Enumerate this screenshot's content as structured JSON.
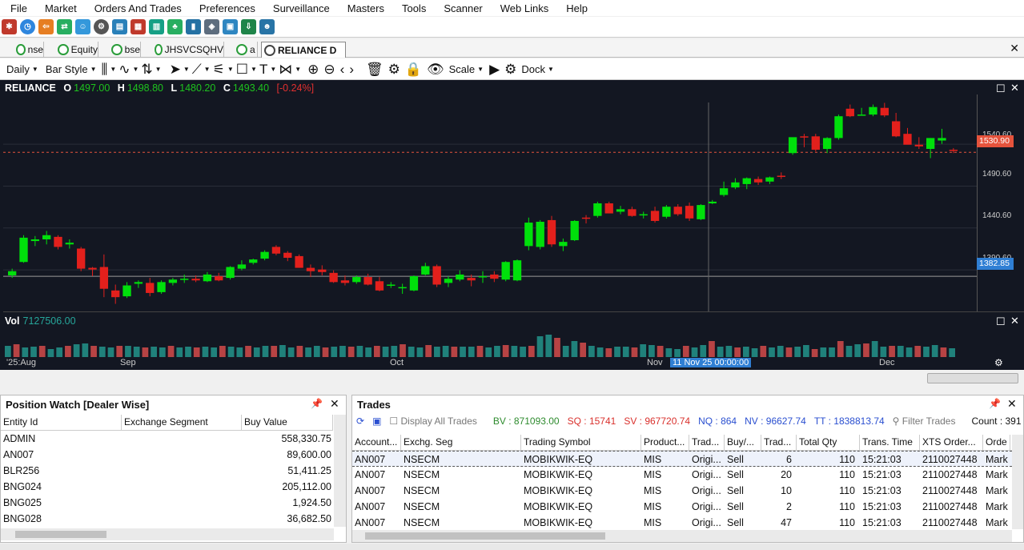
{
  "menu": [
    "File",
    "Market",
    "Orders And Trades",
    "Preferences",
    "Surveillance",
    "Masters",
    "Tools",
    "Scanner",
    "Web Links",
    "Help"
  ],
  "tabs": [
    {
      "label": "nse"
    },
    {
      "label": "Equity"
    },
    {
      "label": "bse"
    },
    {
      "label": "JHSVCSQHV"
    },
    {
      "label": "a"
    },
    {
      "label": "RELIANCE D"
    }
  ],
  "toolbar": {
    "interval": "Daily",
    "style": "Bar Style",
    "scale": "Scale",
    "dock": "Dock"
  },
  "chart": {
    "symbol": "RELIANCE",
    "o_label": "O",
    "o": "1497.00",
    "h_label": "H",
    "h": "1498.80",
    "l_label": "L",
    "l": "1480.20",
    "c_label": "C",
    "c": "1493.40",
    "chg": "[-0.24%]",
    "vol_label": "Vol",
    "vol": "7127506.00",
    "price_ticks": [
      "1540.60",
      "1490.60",
      "1440.60",
      "1390.60"
    ],
    "last_price": "1530.90",
    "cross_price": "1382.85",
    "time_labels": [
      "'25:Aug",
      "Sep",
      "Oct",
      "Nov",
      "Dec"
    ],
    "cross_time": "11 Nov 25 00:00:00",
    "up_color": "#00e00b",
    "down_color": "#e3201c"
  },
  "chart_data": {
    "type": "candlestick",
    "candles": [
      [
        1384,
        1392,
        1381,
        1389
      ],
      [
        1400,
        1432,
        1399,
        1429
      ],
      [
        1425,
        1431,
        1419,
        1427
      ],
      [
        1427,
        1437,
        1421,
        1432
      ],
      [
        1430,
        1432,
        1415,
        1418
      ],
      [
        1421,
        1427,
        1416,
        1423
      ],
      [
        1416,
        1418,
        1389,
        1392
      ],
      [
        1393,
        1394,
        1383,
        1391
      ],
      [
        1394,
        1409,
        1358,
        1368
      ],
      [
        1366,
        1373,
        1350,
        1358
      ],
      [
        1359,
        1376,
        1357,
        1372
      ],
      [
        1374,
        1378,
        1369,
        1376
      ],
      [
        1375,
        1381,
        1359,
        1363
      ],
      [
        1364,
        1378,
        1362,
        1376
      ],
      [
        1375,
        1381,
        1372,
        1379
      ],
      [
        1380,
        1385,
        1375,
        1380
      ],
      [
        1380,
        1384,
        1376,
        1378
      ],
      [
        1377,
        1388,
        1376,
        1385
      ],
      [
        1383,
        1387,
        1377,
        1378
      ],
      [
        1381,
        1395,
        1379,
        1394
      ],
      [
        1392,
        1402,
        1390,
        1397
      ],
      [
        1399,
        1404,
        1397,
        1403
      ],
      [
        1404,
        1414,
        1402,
        1412
      ],
      [
        1418,
        1420,
        1408,
        1410
      ],
      [
        1411,
        1413,
        1401,
        1405
      ],
      [
        1407,
        1409,
        1393,
        1393
      ],
      [
        1393,
        1397,
        1382,
        1389
      ],
      [
        1391,
        1396,
        1384,
        1388
      ],
      [
        1387,
        1390,
        1375,
        1376
      ],
      [
        1378,
        1384,
        1372,
        1375
      ],
      [
        1376,
        1384,
        1374,
        1382
      ],
      [
        1382,
        1386,
        1372,
        1373
      ],
      [
        1377,
        1382,
        1365,
        1366
      ],
      [
        1372,
        1376,
        1369,
        1373
      ],
      [
        1369,
        1374,
        1362,
        1370
      ],
      [
        1366,
        1384,
        1365,
        1383
      ],
      [
        1385,
        1399,
        1384,
        1395
      ],
      [
        1395,
        1397,
        1370,
        1373
      ],
      [
        1375,
        1383,
        1370,
        1380
      ],
      [
        1379,
        1390,
        1377,
        1385
      ],
      [
        1381,
        1385,
        1371,
        1378
      ],
      [
        1382,
        1389,
        1375,
        1383
      ],
      [
        1385,
        1389,
        1376,
        1380
      ],
      [
        1379,
        1401,
        1377,
        1400
      ],
      [
        1378,
        1403,
        1377,
        1402
      ],
      [
        1419,
        1453,
        1414,
        1447
      ],
      [
        1418,
        1450,
        1415,
        1448
      ],
      [
        1450,
        1455,
        1418,
        1421
      ],
      [
        1419,
        1428,
        1413,
        1424
      ],
      [
        1426,
        1450,
        1425,
        1449
      ],
      [
        1453,
        1456,
        1446,
        1452
      ],
      [
        1455,
        1472,
        1453,
        1470
      ],
      [
        1470,
        1472,
        1458,
        1458
      ],
      [
        1460,
        1467,
        1457,
        1463
      ],
      [
        1463,
        1466,
        1454,
        1455
      ],
      [
        1456,
        1460,
        1452,
        1457
      ],
      [
        1461,
        1466,
        1447,
        1449
      ],
      [
        1454,
        1468,
        1452,
        1466
      ],
      [
        1466,
        1469,
        1455,
        1457
      ],
      [
        1467,
        1471,
        1449,
        1452
      ],
      [
        1451,
        1469,
        1450,
        1468
      ],
      [
        1470,
        1474,
        1469,
        1472
      ],
      [
        1480,
        1496,
        1478,
        1488
      ],
      [
        1489,
        1500,
        1487,
        1495
      ],
      [
        1493,
        1501,
        1487,
        1500
      ],
      [
        1499,
        1502,
        1492,
        1495
      ],
      [
        1496,
        1502,
        1493,
        1501
      ],
      [
        1503,
        1507,
        1499,
        1502
      ],
      [
        1530,
        1545,
        1528,
        1549
      ],
      [
        1550,
        1553,
        1537,
        1549
      ],
      [
        1550,
        1553,
        1532,
        1534
      ],
      [
        1535,
        1549,
        1530,
        1548
      ],
      [
        1548,
        1576,
        1546,
        1574
      ],
      [
        1583,
        1588,
        1573,
        1574
      ],
      [
        1575,
        1584,
        1575,
        1576
      ],
      [
        1576,
        1588,
        1574,
        1585
      ],
      [
        1584,
        1590,
        1573,
        1575
      ],
      [
        1568,
        1578,
        1549,
        1550
      ],
      [
        1553,
        1560,
        1542,
        1540
      ],
      [
        1540,
        1549,
        1535,
        1538
      ],
      [
        1535,
        1548,
        1524,
        1548
      ],
      [
        1545,
        1559,
        1541,
        1548
      ],
      [
        1534,
        1536,
        1530,
        1533
      ]
    ],
    "volume_heights": [
      14,
      16,
      12,
      13,
      14,
      10,
      12,
      14,
      16,
      17,
      14,
      13,
      12,
      14,
      14,
      13,
      12,
      13,
      12,
      14,
      12,
      13,
      12,
      13,
      12,
      14,
      13,
      12,
      14,
      12,
      14,
      14,
      15,
      12,
      14,
      12,
      14,
      12,
      13,
      14,
      13,
      14,
      12,
      14,
      13,
      14,
      16,
      13,
      12,
      15,
      13,
      14,
      13,
      13,
      13,
      14,
      12,
      14,
      15,
      14,
      13,
      14,
      26,
      28,
      24,
      14,
      20,
      18,
      14,
      12,
      11,
      13,
      13,
      12,
      16,
      15,
      14,
      11,
      10,
      14,
      12,
      15,
      20,
      13,
      14,
      12,
      13,
      11,
      14,
      12,
      14,
      12,
      13,
      15,
      10,
      12,
      12,
      20,
      14,
      16,
      17,
      20,
      13,
      14,
      14,
      12,
      14,
      13,
      15,
      12,
      11
    ],
    "ylim": [
      1340,
      1600
    ],
    "price_ticks": [
      1540.6,
      1490.6,
      1440.6,
      1390.6
    ],
    "last_price": 1530.9,
    "crosshair_price": 1382.85,
    "crosshair_date": "11 Nov 25 00:00:00",
    "volume": 7127506.0
  },
  "position_watch": {
    "title": "Position Watch [Dealer Wise]",
    "columns": [
      "Entity Id",
      "Exchange Segment",
      "Buy Value"
    ],
    "rows": [
      {
        "entity": "ADMIN",
        "buy": "558,330.75"
      },
      {
        "entity": "AN007",
        "buy": "89,600.00"
      },
      {
        "entity": "BLR256",
        "buy": "51,411.25"
      },
      {
        "entity": "BNG024",
        "buy": "205,112.00"
      },
      {
        "entity": "BNG025",
        "buy": "1,924.50"
      },
      {
        "entity": "BNG028",
        "buy": "36,682.50"
      }
    ]
  },
  "trades": {
    "title": "Trades",
    "display_all": "Display All Trades",
    "bv": "BV : 871093.00",
    "sq": "SQ : 15741",
    "sv": "SV : 967720.74",
    "nq": "NQ : 864",
    "nv": "NV : 96627.74",
    "tt": "TT : 1838813.74",
    "filter": "Filter Trades",
    "count": "Count : 391",
    "columns": [
      "Account...",
      "Exchg. Seg",
      "Trading Symbol",
      "Product...",
      "Trad...",
      "Buy/...",
      "Trad...",
      "Total Qty",
      "Trans. Time",
      "XTS Order...",
      "Orde"
    ],
    "rows": [
      [
        "AN007",
        "NSECM",
        "MOBIKWIK-EQ",
        "MIS",
        "Origi...",
        "Sell",
        "6",
        "110",
        "15:21:03",
        "2110027448",
        "Mark"
      ],
      [
        "AN007",
        "NSECM",
        "MOBIKWIK-EQ",
        "MIS",
        "Origi...",
        "Sell",
        "20",
        "110",
        "15:21:03",
        "2110027448",
        "Mark"
      ],
      [
        "AN007",
        "NSECM",
        "MOBIKWIK-EQ",
        "MIS",
        "Origi...",
        "Sell",
        "10",
        "110",
        "15:21:03",
        "2110027448",
        "Mark"
      ],
      [
        "AN007",
        "NSECM",
        "MOBIKWIK-EQ",
        "MIS",
        "Origi...",
        "Sell",
        "2",
        "110",
        "15:21:03",
        "2110027448",
        "Mark"
      ],
      [
        "AN007",
        "NSECM",
        "MOBIKWIK-EQ",
        "MIS",
        "Origi...",
        "Sell",
        "47",
        "110",
        "15:21:03",
        "2110027448",
        "Mark"
      ]
    ]
  }
}
